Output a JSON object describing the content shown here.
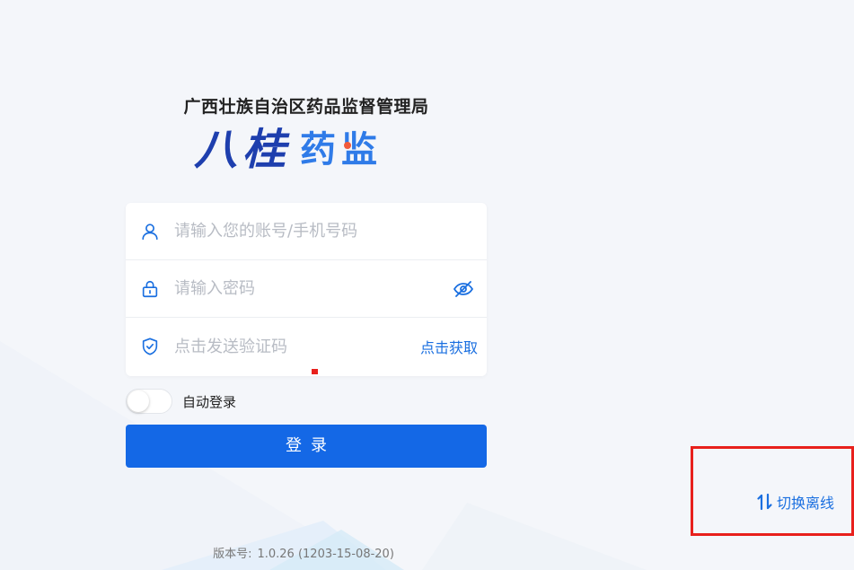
{
  "header": {
    "org_title": "广西壮族自治区药品监督管理局",
    "logo_text": [
      "八",
      "桂",
      "药",
      "监"
    ]
  },
  "form": {
    "account": {
      "placeholder": "请输入您的账号/手机号码",
      "value": "",
      "icon": "user-icon"
    },
    "password": {
      "placeholder": "请输入密码",
      "value": "",
      "icon": "lock-icon",
      "toggle_icon": "eye-off-icon"
    },
    "captcha": {
      "placeholder": "点击发送验证码",
      "value": "",
      "icon": "shield-check-icon",
      "get_code_label": "点击获取"
    }
  },
  "auto_login": {
    "label": "自动登录",
    "enabled": false
  },
  "login_button": {
    "label": "登录"
  },
  "footer": {
    "version_label": "版本号:",
    "version_value": "1.0.26 (1203-15-08-20)"
  },
  "switch_offline": {
    "label": "切换离线",
    "icon": "swap-vertical-icon"
  },
  "colors": {
    "primary": "#1468e6",
    "link": "#1a6fe0",
    "background": "#f4f6fa",
    "highlight_box": "#e8201c"
  }
}
